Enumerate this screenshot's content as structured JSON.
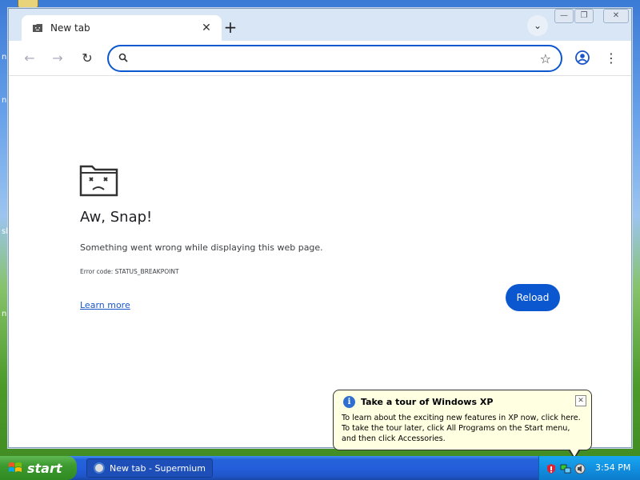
{
  "browser": {
    "tab_title": "New tab",
    "tab_close_symbol": "✕",
    "new_tab_symbol": "+",
    "tab_search_symbol": "⌄",
    "omnibox_value": "",
    "window_controls": {
      "minimize": "—",
      "maximize": "❐",
      "close": "✕"
    }
  },
  "toolbar": {
    "back_symbol": "←",
    "forward_symbol": "→",
    "reload_symbol": "↻",
    "star_symbol": "☆",
    "menu_symbol": "⋮"
  },
  "error_page": {
    "heading": "Aw, Snap!",
    "message": "Something went wrong while displaying this web page.",
    "error_code": "Error code: STATUS_BREAKPOINT",
    "learn_more": "Learn more",
    "reload_label": "Reload"
  },
  "balloon": {
    "info_symbol": "i",
    "title": "Take a tour of Windows XP",
    "close_symbol": "✕",
    "body_line1": "To learn about the exciting new features in XP now, click here.",
    "body_line2": "To take the tour later, click All Programs on the Start menu,",
    "body_line3": "and then click Accessories."
  },
  "taskbar": {
    "start_label": "start",
    "task_label": "New tab - Supermium",
    "clock": "3:54 PM"
  },
  "desktop": {
    "edge_fragments": [
      "n",
      "n",
      "sl",
      "n"
    ]
  },
  "colors": {
    "accent": "#0b57d0",
    "taskbar": "#245edb",
    "start": "#3c9a2f",
    "balloon_bg": "#ffffe1"
  },
  "icons": [
    "folder-sad-icon",
    "search-icon",
    "star-icon",
    "profile-icon",
    "menu-icon",
    "info-icon",
    "windows-logo-icon",
    "shield-icon",
    "network-icon",
    "volume-icon"
  ]
}
